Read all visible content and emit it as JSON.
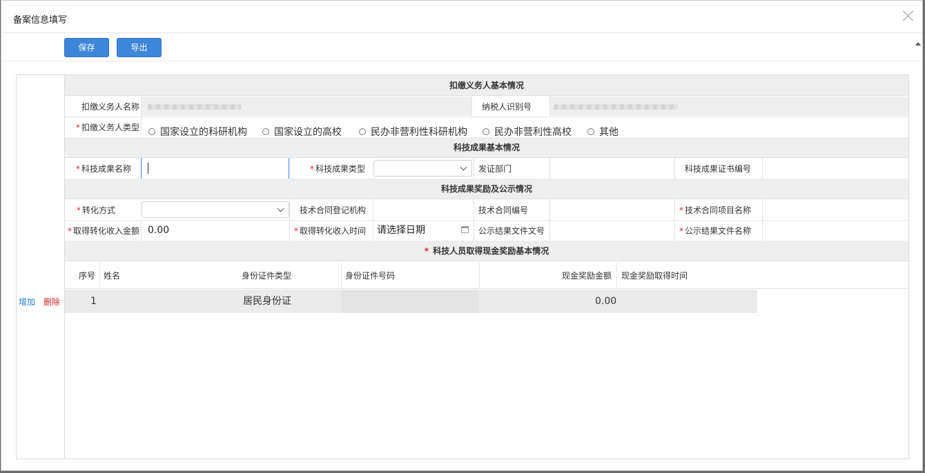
{
  "dialog": {
    "title": "备案信息填写"
  },
  "toolbar": {
    "save_label": "保存",
    "export_label": "导出"
  },
  "side": {
    "add_label": "增加",
    "delete_label": "删除"
  },
  "required_mark": "*",
  "sections": {
    "payer_basic": "扣缴义务人基本情况",
    "achievement_basic": "科技成果基本情况",
    "reward_public": "科技成果奖励及公示情况",
    "staff_reward": "科技人员取得现金奖励基本情况"
  },
  "payer": {
    "name_label": "扣缴义务人名称",
    "taxid_label": "纳税人识别号",
    "type_label": "扣缴义务人类型",
    "type_options": [
      "国家设立的科研机构",
      "国家设立的高校",
      "民办非营利性科研机构",
      "民办非营利性高校",
      "其他"
    ]
  },
  "achievement": {
    "name_label": "科技成果名称",
    "type_label": "科技成果类型",
    "dept_label": "发证部门",
    "cert_label": "科技成果证书编号"
  },
  "reward": {
    "method_label": "转化方式",
    "contract_org_label": "技术合同登记机构",
    "contract_no_label": "技术合同编号",
    "contract_project_label": "技术合同项目名称",
    "income_amount_label": "取得转化收入金额",
    "income_amount_value": "0.00",
    "income_time_label": "取得转化收入时间",
    "income_time_placeholder": "请选择日期",
    "public_doc_no_label": "公示结果文件文号",
    "public_doc_name_label": "公示结果文件名称"
  },
  "staff_table": {
    "headers": [
      "序号",
      "姓名",
      "身份证件类型",
      "身份证件号码",
      "现金奖励金额",
      "现金奖励取得时间"
    ],
    "rows": [
      {
        "index": "1",
        "name": "",
        "id_type": "居民身份证",
        "id_no": "",
        "amount": "0.00",
        "time": ""
      }
    ]
  },
  "icons": {
    "close": "close-icon",
    "calendar": "calendar-icon",
    "dropdown": "chevron-down-icon"
  }
}
